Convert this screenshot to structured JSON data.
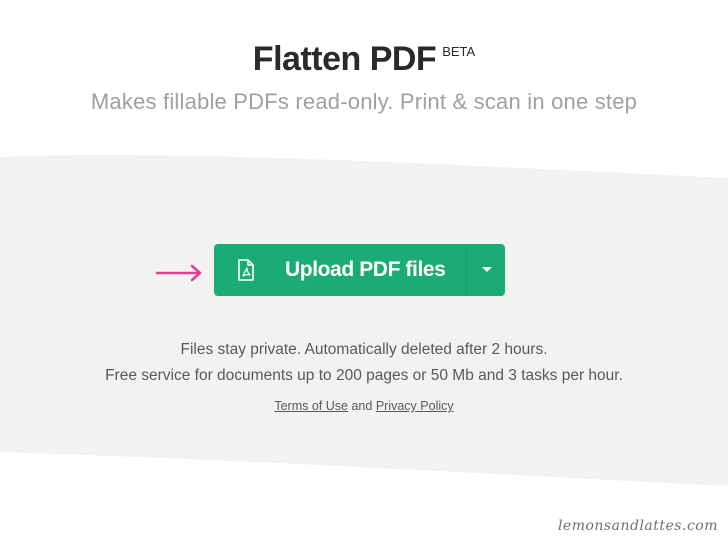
{
  "header": {
    "title": "Flatten PDF",
    "badge": "BETA",
    "subtitle": "Makes fillable PDFs read-only. Print & scan in one step"
  },
  "upload": {
    "label": "Upload PDF files",
    "icon": "pdf-file-icon",
    "dropdown_icon": "caret-down-icon",
    "accent_color": "#1aac74",
    "pointer_icon": "arrow-right-icon",
    "pointer_color": "#e0408f"
  },
  "info": {
    "line1": "Files stay private. Automatically deleted after 2 hours.",
    "line2": "Free service for documents up to 200 pages or 50 Mb and 3 tasks per hour."
  },
  "legal": {
    "terms": "Terms of Use",
    "and": "and",
    "privacy": "Privacy Policy"
  },
  "watermark": "lemonsandlattes.com"
}
